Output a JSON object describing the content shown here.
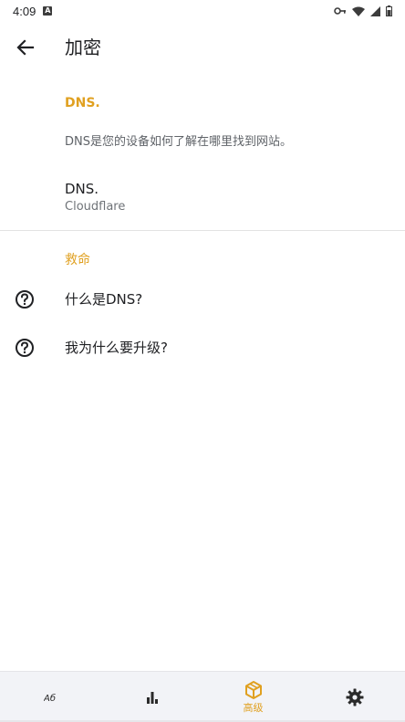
{
  "status_bar": {
    "time": "4:09",
    "notification_glyph": "A"
  },
  "header": {
    "title": "加密"
  },
  "dns_section": {
    "header": "DNS.",
    "description": "DNS是您的设备如何了解在哪里找到网站。",
    "item": {
      "title": "DNS.",
      "subtitle": "Cloudflare"
    }
  },
  "help_section": {
    "header": "救命",
    "items": [
      {
        "label": "什么是DNS?",
        "icon": "help-circle-icon"
      },
      {
        "label": "我为什么要升级?",
        "icon": "help-circle-icon"
      }
    ]
  },
  "bottom_nav": {
    "items": [
      {
        "icon": "translate-icon",
        "label": ""
      },
      {
        "icon": "bar-chart-icon",
        "label": ""
      },
      {
        "icon": "package-icon",
        "label": "高级",
        "active": true
      },
      {
        "icon": "gear-icon",
        "label": ""
      }
    ]
  },
  "colors": {
    "accent": "#e0a020",
    "text_primary": "#202124",
    "text_secondary": "#5f6368",
    "nav_background": "#f2f3f7"
  }
}
